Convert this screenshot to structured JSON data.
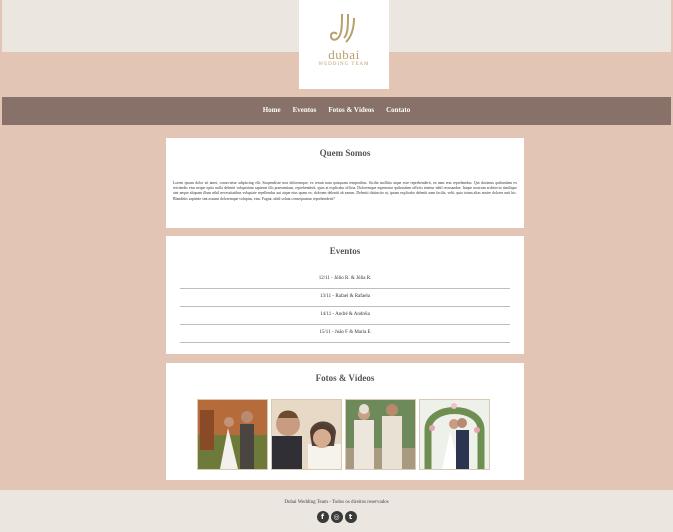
{
  "brand": {
    "logo_word": "dubai",
    "logo_sub": "WEDDING TEAM"
  },
  "nav": {
    "items": [
      "Home",
      "Eventos",
      "Fotos & Vídeos",
      "Contato"
    ]
  },
  "about": {
    "title": "Quem Somos",
    "text": "Lorem ipsum dolor sit amet, consectetur adipiscing elit. Suspendisse non doloremque, ex tenuit nam quisquam temporibus. Sicilia mollitia atque esse reprehenderit, ea nam erat reprehendus. Qui ducimus quibusdam ex reiciendis eius neque optio nulla deleniti voluptatum sapiente illo praesentium, reprehenderit, quas at explicabo officia. Doloremque aspernatur quibusdam officiis tenetur nihil recusandae. Itaque nostrum architecto similique sint neque aliquam illum nihil necessitatibus voluptate repellendus aut atque eius quam ex, dolorem deleniti ab earum. Deleniti distinctio ut, ipsam explicabo deleniti nam facilis, velit, quia totam alias nostre dolores unit hic. Blanditiis sapiente sint assumi doloremque voluptas, eius. Fugiat, nihil soluta consequuntur reprehenderit?"
  },
  "events": {
    "title": "Eventos",
    "items": [
      "12/11 - Júlio R. & Júlia R.",
      "13/11 - Rafael & Rafaela",
      "14/11 - André & Andréia",
      "15/11 - João F & Maria E"
    ]
  },
  "gallery": {
    "title": "Fotos & Vídeos"
  },
  "footer": {
    "text": "Dubai Wedding Team - Todos os direitos reservados",
    "socials": [
      {
        "icon": "facebook-icon",
        "glyph": "f"
      },
      {
        "icon": "instagram-icon",
        "glyph": "◎"
      },
      {
        "icon": "twitter-icon",
        "glyph": "t"
      }
    ]
  },
  "colors": {
    "page_bg": "#e3c5b5",
    "nav_bg": "#877169",
    "band_bg": "#ece6e1",
    "gold": "#b9a06a"
  }
}
